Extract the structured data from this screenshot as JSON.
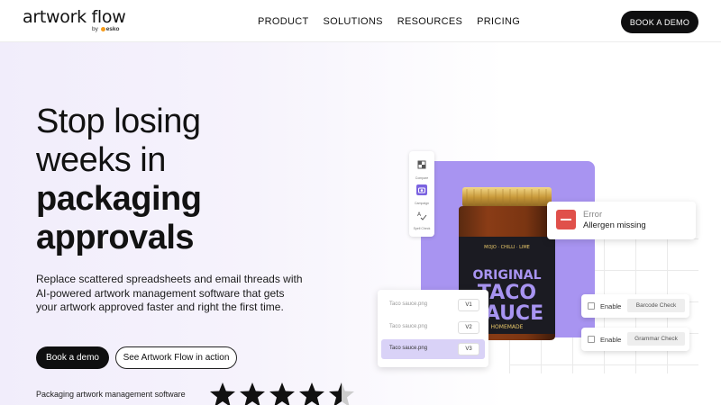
{
  "brand": {
    "name": "artwork flow",
    "by": "by",
    "by_brand": "esko"
  },
  "nav": {
    "links": [
      "PRODUCT",
      "SOLUTIONS",
      "RESOURCES",
      "PRICING"
    ],
    "cta": "BOOK A DEMO"
  },
  "hero": {
    "lines": [
      "Stop losing",
      "weeks in",
      "packaging",
      "approvals"
    ],
    "subtitle": "Replace scattered spreadsheets and email threads with AI-powered artwork management software that gets your artwork approved faster and right the first time.",
    "primary_button": "Book a demo",
    "secondary_button": "See Artwork Flow in action",
    "tagline": "Packaging artwork management software",
    "rating": 4.5
  },
  "product_visual": {
    "jar_label": {
      "top": "MOJO · CHILLI · LIME",
      "line1": "ORIGINAL",
      "line2": "TACO",
      "line3": "SAUCE",
      "line4": "HOMEMADE"
    },
    "toolbar": [
      {
        "label": "Compare",
        "icon": "compare-icon"
      },
      {
        "label": "Campaign",
        "icon": "camera-icon"
      },
      {
        "label": "Spell Check",
        "icon": "spellcheck-icon"
      }
    ],
    "error": {
      "title": "Error",
      "message": "Allergen missing"
    },
    "versions": [
      {
        "file": "Taco sauce.png",
        "version": "V1"
      },
      {
        "file": "Taco sauce.png",
        "version": "V2"
      },
      {
        "file": "Taco sauce.png",
        "version": "V3"
      }
    ],
    "checks": [
      {
        "enable": "Enable",
        "name": "Barcode Check"
      },
      {
        "enable": "Enable",
        "name": "Grammar Check"
      }
    ]
  },
  "colors": {
    "accent_purple": "#a894f1",
    "error_red": "#e0504a",
    "dark": "#0f0f10"
  }
}
